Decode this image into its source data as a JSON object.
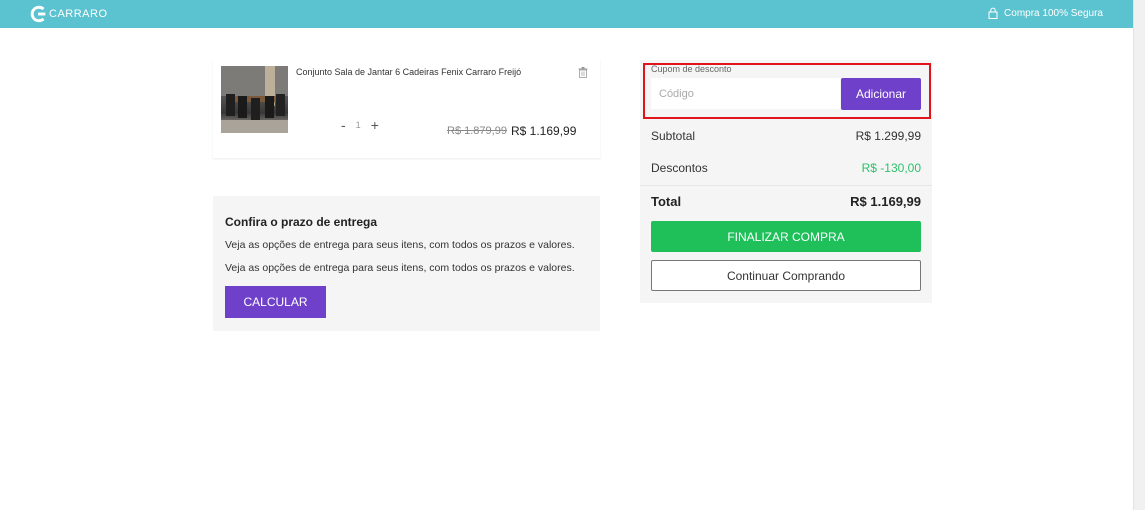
{
  "header": {
    "logo_text": "CARRARO",
    "secure_text": "Compra 100% Segura",
    "bg_color": "#5bc3d0"
  },
  "cart": {
    "item": {
      "name": "Conjunto Sala de Jantar 6 Cadeiras Fenix Carraro Freijó",
      "quantity": "1",
      "minus_label": "-",
      "plus_label": "+",
      "old_price": "R$ 1.879,99",
      "price": "R$ 1.169,99"
    }
  },
  "delivery": {
    "title": "Confira o prazo de entrega",
    "text1": "Veja as opções de entrega para seus itens, com todos os prazos e valores.",
    "text2": "Veja as opções de entrega para seus itens, com todos os prazos e valores.",
    "button_label": "CALCULAR"
  },
  "summary": {
    "coupon_label": "Cupom de desconto",
    "coupon_placeholder": "Código",
    "coupon_button": "Adicionar",
    "subtotal_label": "Subtotal",
    "subtotal_value": "R$ 1.299,99",
    "discount_label": "Descontos",
    "discount_value": "R$ -130,00",
    "total_label": "Total",
    "total_value": "R$ 1.169,99",
    "finish_button": "FINALIZAR COMPRA",
    "continue_button": "Continuar Comprando"
  },
  "colors": {
    "accent_purple": "#6f40c9",
    "finish_green": "#1fbf5a",
    "discount_green": "#2ec06b",
    "highlight_red": "#e0141a"
  }
}
